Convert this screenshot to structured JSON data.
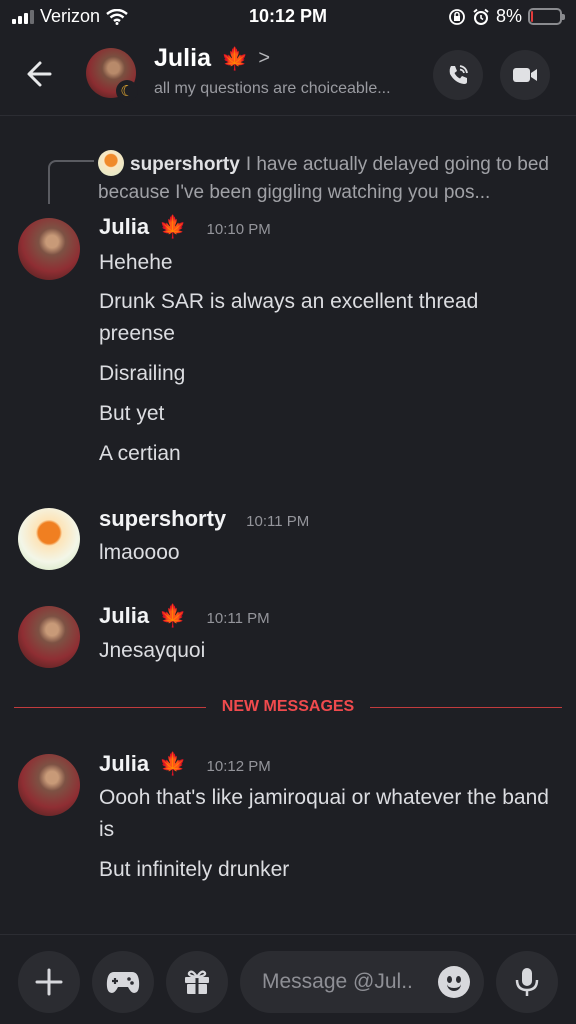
{
  "status_bar": {
    "carrier": "Verizon",
    "time": "10:12 PM",
    "battery": "8%",
    "battery_fraction": 0.08
  },
  "header": {
    "name": "Julia",
    "status": "all my questions are choiceable...",
    "icons": {
      "back": "arrow-left-icon",
      "call": "phone-call-icon",
      "video": "video-camera-icon",
      "leaf": "maple-leaf-icon"
    }
  },
  "reply": {
    "user": "supershorty",
    "text": "I have actually delayed going to bed because I've been giggling watching you pos..."
  },
  "messages": [
    {
      "user": "Julia",
      "time": "10:10 PM",
      "lines": [
        "Hehehe",
        "Drunk SAR is always an excellent thread preense",
        "Disrailing",
        "But yet",
        "A certian"
      ]
    },
    {
      "user": "supershorty",
      "time": "10:11 PM",
      "lines": [
        "lmaoooo"
      ]
    },
    {
      "user": "Julia",
      "time": "10:11 PM",
      "lines": [
        "Jnesayquoi"
      ]
    },
    {
      "user": "Julia",
      "time": "10:12 PM",
      "lines": [
        "Oooh that's like jamiroquai or whatever the band is",
        "But infinitely drunker"
      ]
    }
  ],
  "divider": {
    "label": "NEW MESSAGES"
  },
  "composer": {
    "placeholder": "Message @Jul..",
    "icons": [
      "plus-icon",
      "gamepad-icon",
      "gift-icon",
      "emoji-icon",
      "microphone-icon"
    ]
  },
  "colors": {
    "background": "#1e1f24",
    "new_messages": "#f04a4d",
    "leaf": "#e4572e"
  }
}
